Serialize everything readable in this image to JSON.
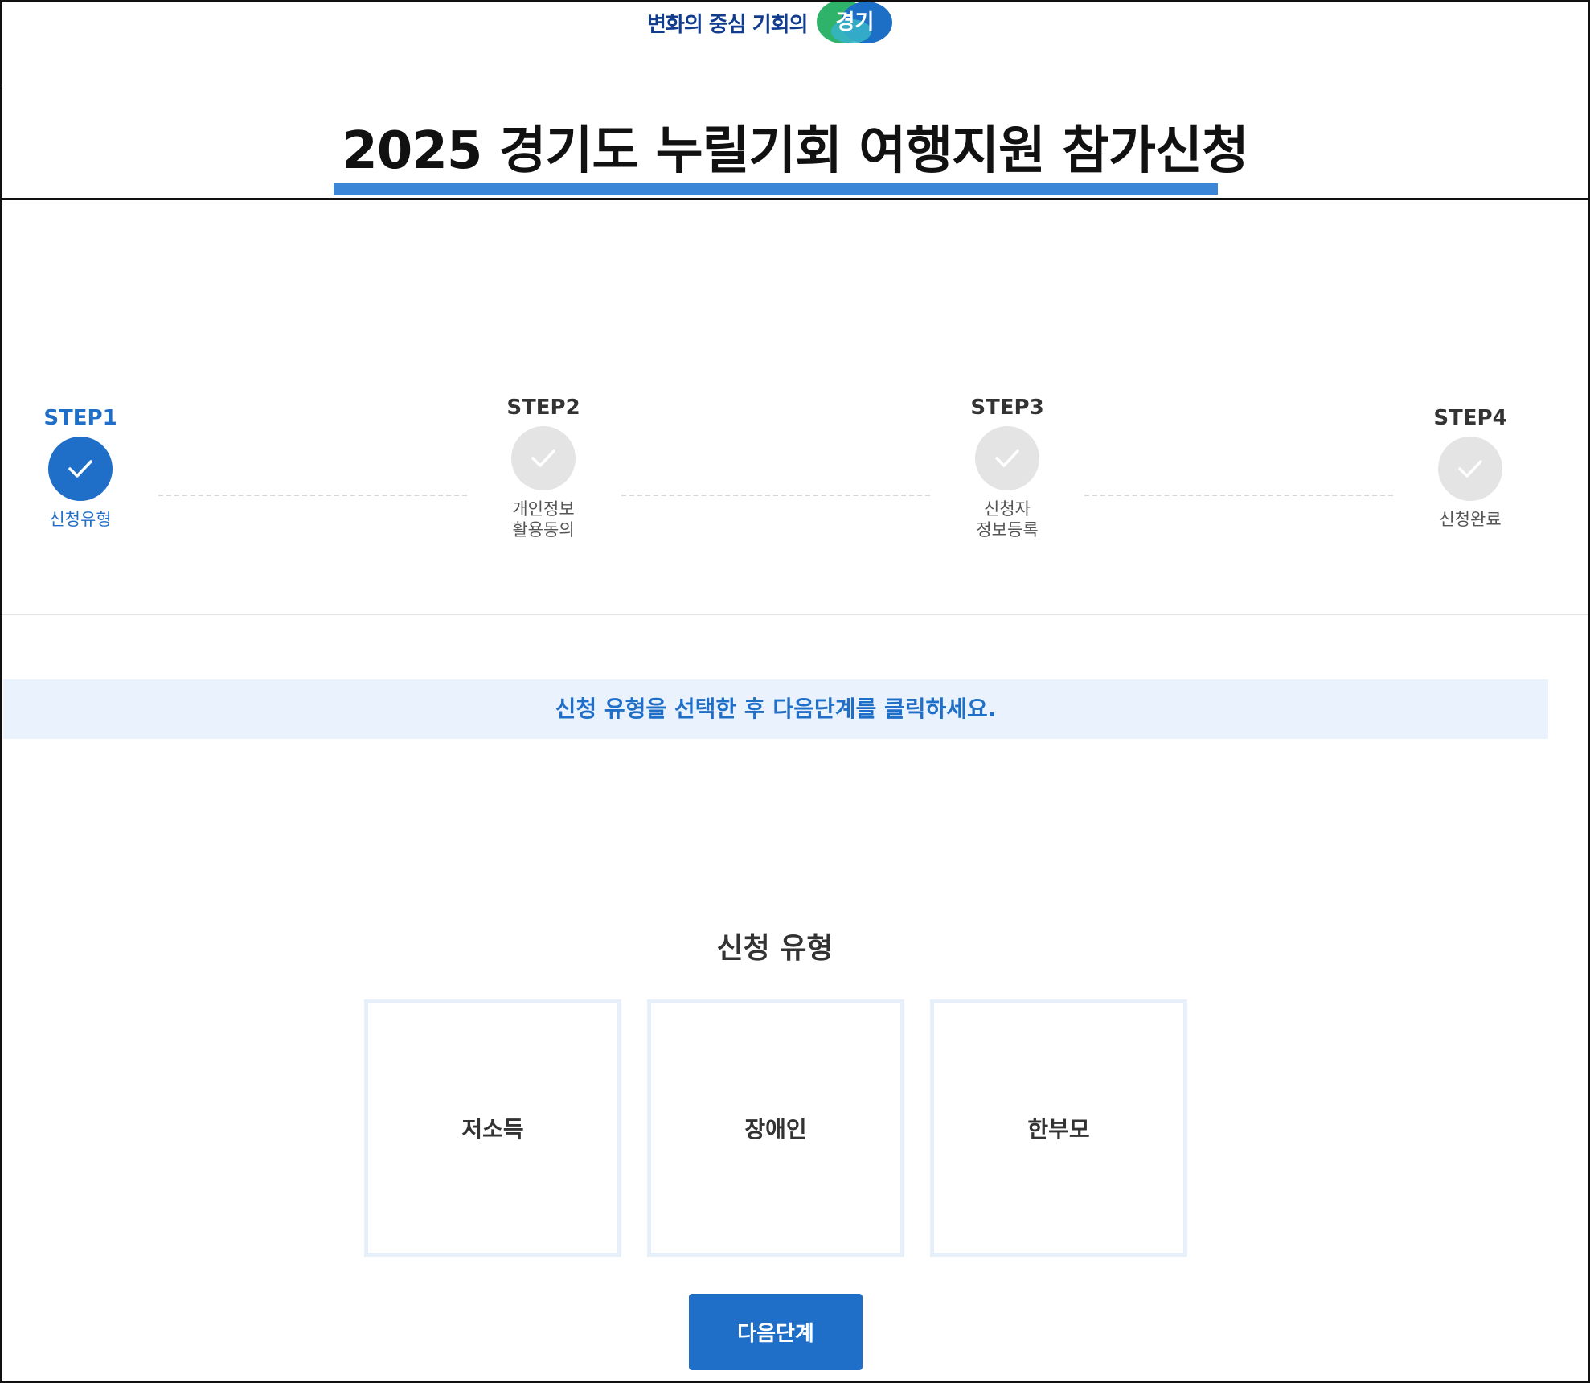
{
  "header": {
    "logo_slogan": "변화의 중심 기회의",
    "logo_badge": "경기",
    "page_title": "2025 경기도 누릴기회 여행지원 참가신청"
  },
  "stepper": {
    "steps": [
      {
        "label": "STEP1",
        "sub": "신청유형",
        "state": "active"
      },
      {
        "label": "STEP2",
        "sub": "개인정보\n활용동의",
        "state": "inactive"
      },
      {
        "label": "STEP3",
        "sub": "신청자\n정보등록",
        "state": "inactive"
      },
      {
        "label": "STEP4",
        "sub": "신청완료",
        "state": "inactive"
      }
    ]
  },
  "notice": "신청 유형을 선택한 후 다음단계를 클릭하세요.",
  "type_section": {
    "title": "신청 유형",
    "options": [
      "저소득",
      "장애인",
      "한부모"
    ]
  },
  "next_button": "다음단계",
  "colors": {
    "accent": "#1f6ec8",
    "title_underline": "#3b86d6",
    "notice_bg": "#eaf3fd",
    "inactive_step": "#e4e4e4",
    "card_border": "#e6effa"
  }
}
